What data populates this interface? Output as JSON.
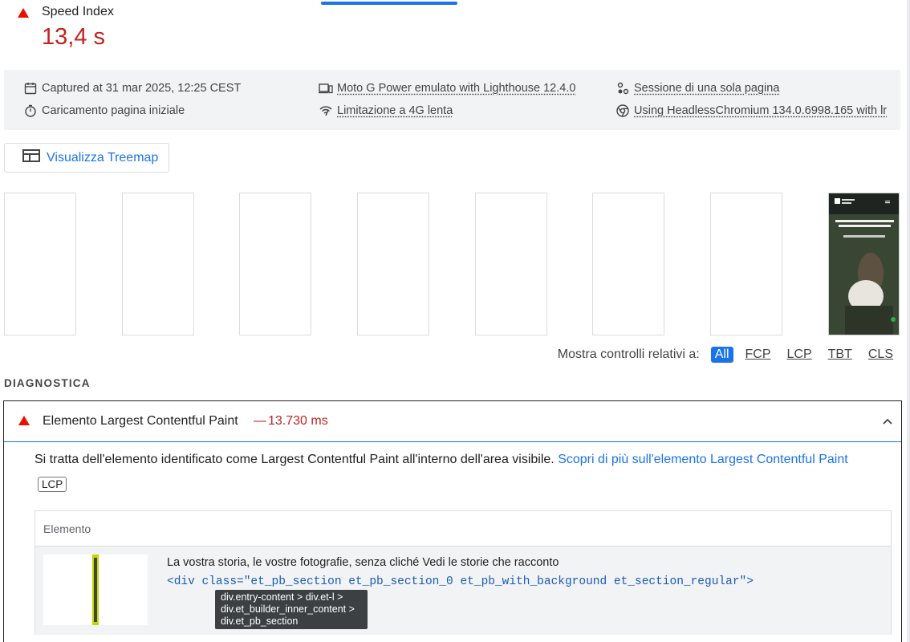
{
  "metric": {
    "label": "Speed Index",
    "value": "13,4 s",
    "status": "fail"
  },
  "environment": {
    "captured": "Captured at 31 mar 2025, 12:25 CEST",
    "load_type": "Caricamento pagina iniziale",
    "device": "Moto G Power emulato with Lighthouse 12.4.0",
    "throttling": "Limitazione a 4G lenta",
    "session": "Sessione di una sola pagina",
    "browser": "Using HeadlessChromium 134.0.6998.165 with lr"
  },
  "treemap_button": {
    "label": "Visualizza Treemap"
  },
  "filmstrip": {
    "frame_count": 8
  },
  "filter": {
    "label": "Mostra controlli relativi a:",
    "options": [
      "All",
      "FCP",
      "LCP",
      "TBT",
      "CLS"
    ],
    "selected": "All"
  },
  "diagnostics_title": "DIAGNOSTICA",
  "audit": {
    "title": "Elemento Largest Contentful Paint",
    "separator": "—",
    "value": "13.730 ms",
    "description": "Si tratta dell'elemento identificato come Largest Contentful Paint all'interno dell'area visibile. ",
    "link": "Scopri di più sull'elemento Largest Contentful Paint",
    "badge": "LCP",
    "table": {
      "header": "Elemento",
      "row": {
        "text": "La vostra storia, le vostre fotografie, senza cliché Vedi le storie che racconto",
        "snippet": "<div class=\"et_pb_section et_pb_section_0 et_pb_with_background et_section_regular\">"
      }
    }
  },
  "tooltip": {
    "line1": "div.entry-content > div.et-l >",
    "line2": "div.et_builder_inner_content >",
    "line3": "div.et_pb_section"
  },
  "colors": {
    "fail": "#c5221f",
    "accent": "#1a73e8"
  }
}
